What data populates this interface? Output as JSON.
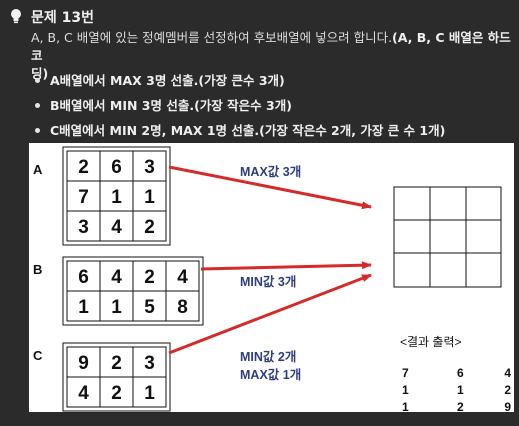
{
  "header": {
    "icon": "lightbulb-icon",
    "title": "문제 13번"
  },
  "description": {
    "line1_plain": "A, B, C 배열에 있는 정예멤버를 선정하여 후보배열에 넣으려 합니다.",
    "line1_bold": "(A, B, C 배열은 하드코",
    "line2_bold": "딩)"
  },
  "bullets": [
    "A배열에서 MAX 3명 선출.(가장 큰수 3개)",
    "B배열에서 MIN 3명 선출.(가장 작은수 3개)",
    "C배열에서 MIN 2명, MAX 1명 선출.(가장 작은수 2개, 가장 큰 수 1개)"
  ],
  "figure": {
    "array_labels": [
      "A",
      "B",
      "C"
    ],
    "array_a": [
      [
        "2",
        "6",
        "3"
      ],
      [
        "7",
        "1",
        "1"
      ],
      [
        "3",
        "4",
        "2"
      ]
    ],
    "array_b": [
      [
        "6",
        "4",
        "2",
        "4"
      ],
      [
        "1",
        "1",
        "5",
        "8"
      ]
    ],
    "array_c": [
      [
        "9",
        "2",
        "3"
      ],
      [
        "4",
        "2",
        "1"
      ]
    ],
    "arrow_label_a": "MAX값 3개",
    "arrow_label_b": "MIN값 3개",
    "arrow_label_c_line1": "MIN값 2개",
    "arrow_label_c_line2": "MAX값 1개",
    "result_title": "<결과 출력>",
    "result_values": [
      [
        "7",
        "6",
        "4"
      ],
      [
        "1",
        "1",
        "2"
      ],
      [
        "1",
        "2",
        "9"
      ]
    ],
    "arrow_color": "#d42a2a",
    "label_color": "#2e3e7e"
  }
}
